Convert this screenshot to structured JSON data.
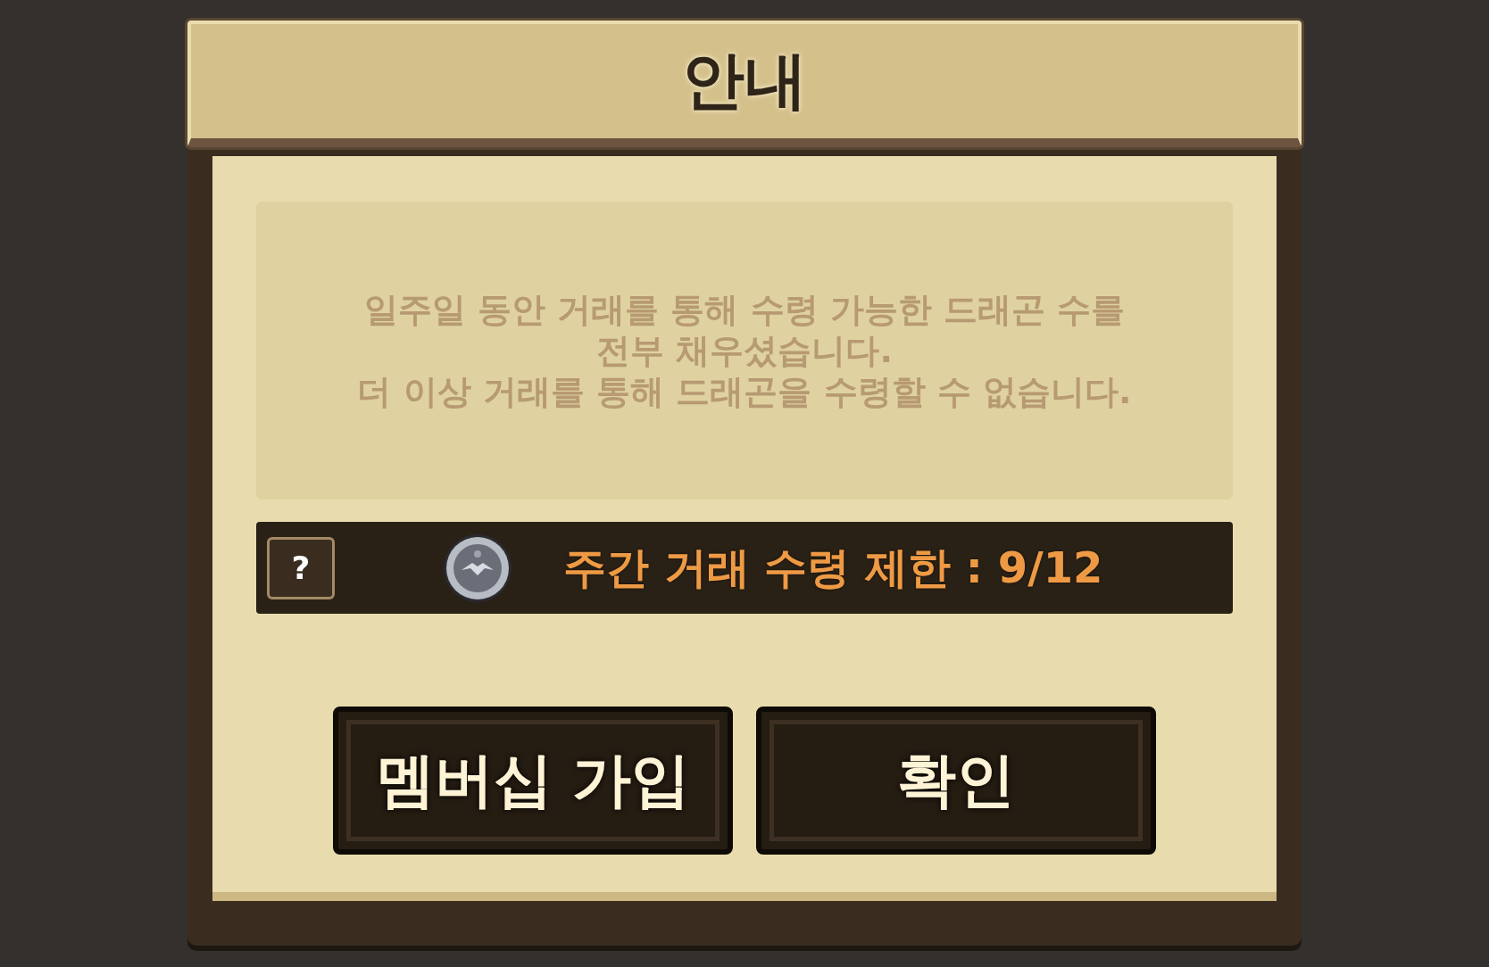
{
  "dialog": {
    "title": "안내",
    "message": [
      "일주일 동안 거래를 통해 수령 가능한 드래곤 수를",
      "전부 채우셨습니다.",
      "더 이상 거래를 통해 드래곤을 수령할 수 없습니다."
    ],
    "limit": {
      "help": "?",
      "label": "주간 거래 수령 제한 : 9/12"
    },
    "buttons": [
      {
        "label": "멤버십 가입"
      },
      {
        "label": "확인"
      }
    ]
  }
}
